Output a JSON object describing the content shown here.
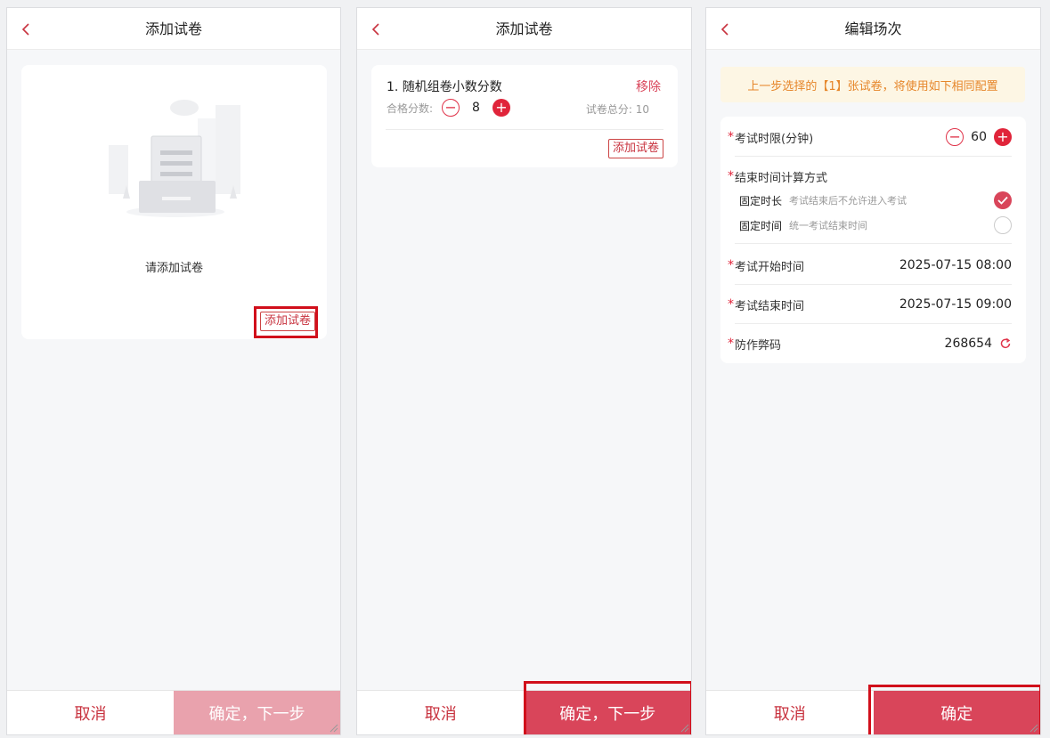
{
  "panel1": {
    "header_title": "添加试卷",
    "empty_text": "请添加试卷",
    "add_button": "添加试卷",
    "cancel": "取消",
    "confirm": "确定，下一步"
  },
  "panel2": {
    "header_title": "添加试卷",
    "paper_title": "1. 随机组卷小数分数",
    "remove": "移除",
    "pass_label": "合格分数:",
    "pass_value": "8",
    "total_label": "试卷总分: 10",
    "add_button": "添加试卷",
    "cancel": "取消",
    "confirm": "确定，下一步"
  },
  "panel3": {
    "header_title": "编辑场次",
    "notice": "上一步选择的【1】张试卷，将使用如下相同配置",
    "duration_label": "考试时限(分钟)",
    "duration_value": "60",
    "end_calc_label": "结束时间计算方式",
    "option1_label": "固定时长",
    "option1_desc": "考试结束后不允许进入考试",
    "option2_label": "固定时间",
    "option2_desc": "统一考试结束时间",
    "start_label": "考试开始时间",
    "start_value": "2025-07-15 08:00",
    "end_label": "考试结束时间",
    "end_value": "2025-07-15 09:00",
    "code_label": "防作弊码",
    "code_value": "268654",
    "cancel": "取消",
    "confirm": "确定"
  },
  "colors": {
    "accent": "#d9455a",
    "disabled": "#e9a2ad",
    "highlight": "#d10f1b",
    "notice_bg": "#fdf6e4",
    "notice_text": "#e6862a"
  },
  "icons": [
    "back-chevron-icon",
    "empty-document-illustration",
    "minus-icon",
    "plus-icon",
    "checkmark-icon",
    "refresh-icon",
    "resize-grip-icon"
  ]
}
